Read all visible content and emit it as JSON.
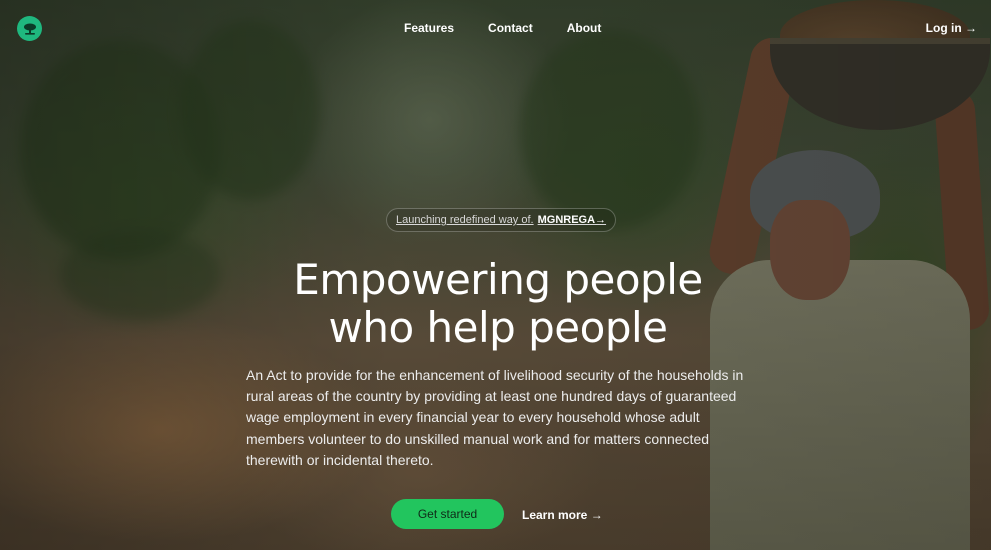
{
  "brand": {
    "accent": "#22c55e",
    "logo_color": "#1fb87f",
    "logo_icon": "tree-icon"
  },
  "nav": {
    "items": [
      {
        "label": "Features"
      },
      {
        "label": "Contact"
      },
      {
        "label": "About"
      }
    ],
    "login_label": "Log in →"
  },
  "hero": {
    "announcement_prefix": "Launching redefined way of.",
    "announcement_highlight": "MGNREGA→",
    "title_line1": "Empowering people",
    "title_line2": "who help people",
    "description": "An Act to provide for the enhancement of livelihood security of the households in rural areas of the country by providing at least one hundred days of guaranteed wage employment in every financial year to every household whose adult members volunteer to do unskilled manual work and for matters connected therewith or incidental thereto.",
    "primary_cta": "Get started",
    "secondary_cta": "Learn more →"
  }
}
